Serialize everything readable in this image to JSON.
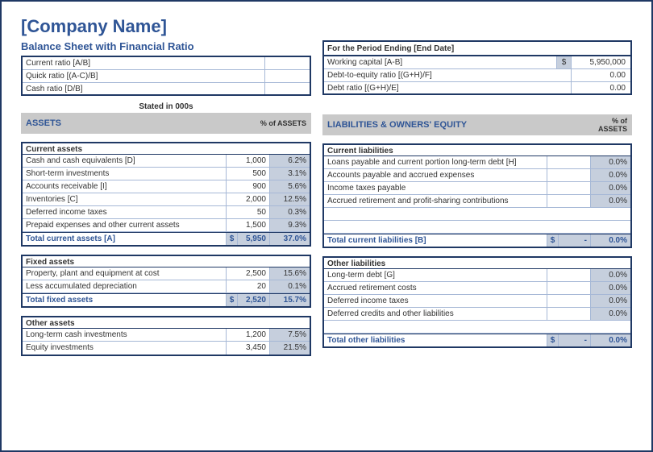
{
  "company": "[Company Name]",
  "title": "Balance Sheet with Financial Ratio",
  "ratios": {
    "current": "Current ratio [A/B]",
    "quick": "Quick ratio [(A-C)/B]",
    "cash": "Cash ratio [D/B]"
  },
  "period_header": "For the Period Ending [End Date]",
  "period": {
    "working_capital_label": "Working capital [A-B]",
    "working_capital_cur": "$",
    "working_capital_val": "5,950,000",
    "debt_equity_label": "Debt-to-equity ratio [(G+H)/F]",
    "debt_equity_val": "0.00",
    "debt_ratio_label": "Debt ratio [(G+H)/E]",
    "debt_ratio_val": "0.00"
  },
  "stated": "Stated in 000s",
  "assets_header": "ASSETS",
  "liab_header": "LIABILITIES & OWNERS' EQUITY",
  "pct_header": "% of ASSETS",
  "current_assets": {
    "head": "Current assets",
    "rows": [
      {
        "l": "Cash and cash equivalents [D]",
        "v": "1,000",
        "p": "6.2%"
      },
      {
        "l": "Short-term investments",
        "v": "500",
        "p": "3.1%"
      },
      {
        "l": "Accounts receivable [I]",
        "v": "900",
        "p": "5.6%"
      },
      {
        "l": "Inventories [C]",
        "v": "2,000",
        "p": "12.5%"
      },
      {
        "l": "Deferred income taxes",
        "v": "50",
        "p": "0.3%"
      },
      {
        "l": "Prepaid expenses and other current assets",
        "v": "1,500",
        "p": "9.3%"
      }
    ],
    "total_label": "Total current assets [A]",
    "total_cur": "$",
    "total_val": "5,950",
    "total_pct": "37.0%"
  },
  "fixed_assets": {
    "head": "Fixed assets",
    "rows": [
      {
        "l": "Property, plant and equipment at cost",
        "v": "2,500",
        "p": "15.6%"
      },
      {
        "l": "Less accumulated depreciation",
        "v": "20",
        "p": "0.1%"
      }
    ],
    "total_label": "Total fixed assets",
    "total_cur": "$",
    "total_val": "2,520",
    "total_pct": "15.7%"
  },
  "other_assets": {
    "head": "Other assets",
    "rows": [
      {
        "l": "Long-term cash investments",
        "v": "1,200",
        "p": "7.5%"
      },
      {
        "l": "Equity investments",
        "v": "3,450",
        "p": "21.5%"
      }
    ]
  },
  "current_liab": {
    "head": "Current liabilities",
    "rows": [
      {
        "l": "Loans payable and current portion long-term debt [H]",
        "p": "0.0%"
      },
      {
        "l": "Accounts payable and accrued expenses",
        "p": "0.0%"
      },
      {
        "l": "Income taxes payable",
        "p": "0.0%"
      },
      {
        "l": "Accrued retirement and profit-sharing contributions",
        "p": "0.0%"
      }
    ],
    "total_label": "Total current liabilities [B]",
    "total_cur": "$",
    "total_val": "-",
    "total_pct": "0.0%"
  },
  "other_liab": {
    "head": "Other liabilities",
    "rows": [
      {
        "l": "Long-term debt [G]",
        "p": "0.0%"
      },
      {
        "l": "Accrued retirement costs",
        "p": "0.0%"
      },
      {
        "l": "Deferred income taxes",
        "p": "0.0%"
      },
      {
        "l": "Deferred credits and other liabilities",
        "p": "0.0%"
      }
    ],
    "total_label": "Total other liabilities",
    "total_cur": "$",
    "total_val": "-",
    "total_pct": "0.0%"
  }
}
